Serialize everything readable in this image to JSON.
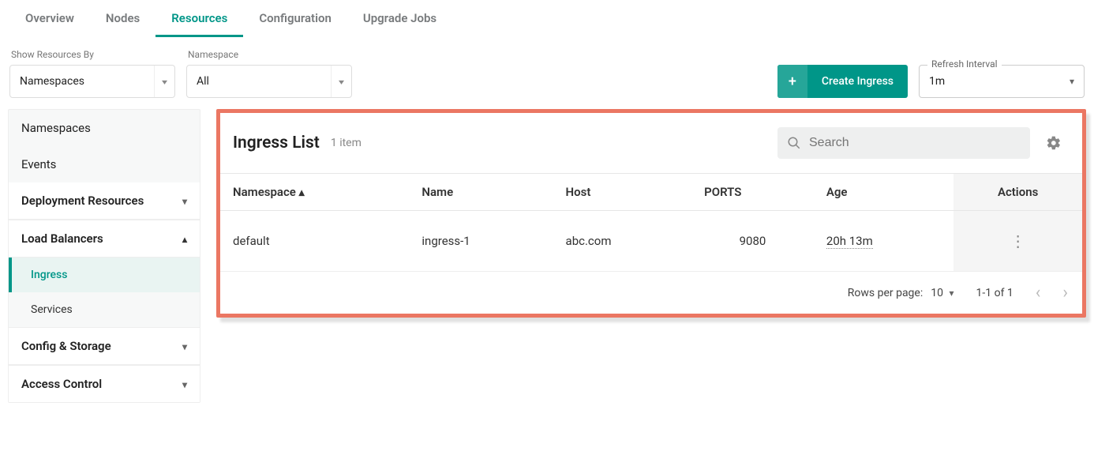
{
  "tabs": [
    {
      "label": "Overview",
      "active": false
    },
    {
      "label": "Nodes",
      "active": false
    },
    {
      "label": "Resources",
      "active": true
    },
    {
      "label": "Configuration",
      "active": false
    },
    {
      "label": "Upgrade Jobs",
      "active": false
    }
  ],
  "filters": {
    "show_by_label": "Show Resources By",
    "show_by_value": "Namespaces",
    "namespace_label": "Namespace",
    "namespace_value": "All"
  },
  "create_button": {
    "icon": "+",
    "label": "Create Ingress"
  },
  "refresh": {
    "label": "Refresh Interval",
    "value": "1m"
  },
  "sidebar": {
    "top_items": [
      "Namespaces",
      "Events"
    ],
    "groups": [
      {
        "label": "Deployment Resources",
        "expanded": false,
        "items": []
      },
      {
        "label": "Load Balancers",
        "expanded": true,
        "items": [
          {
            "label": "Ingress",
            "active": true
          },
          {
            "label": "Services",
            "active": false
          }
        ]
      },
      {
        "label": "Config & Storage",
        "expanded": false,
        "items": []
      },
      {
        "label": "Access Control",
        "expanded": false,
        "items": []
      }
    ]
  },
  "panel": {
    "title": "Ingress List",
    "count_text": "1 item",
    "search_placeholder": "Search",
    "columns": {
      "namespace": "Namespace",
      "name": "Name",
      "host": "Host",
      "ports": "PORTS",
      "age": "Age",
      "actions": "Actions"
    },
    "rows": [
      {
        "namespace": "default",
        "name": "ingress-1",
        "host": "abc.com",
        "ports": "9080",
        "age": "20h 13m"
      }
    ],
    "pager": {
      "rpp_label": "Rows per page:",
      "rpp_value": "10",
      "range": "1-1 of 1"
    }
  }
}
